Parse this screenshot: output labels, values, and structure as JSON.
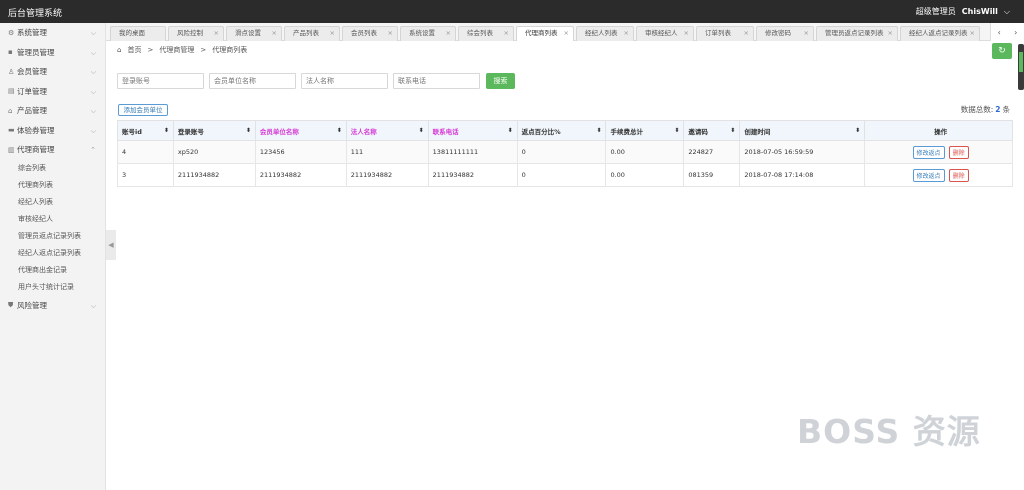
{
  "header": {
    "title": "后台管理系统",
    "role": "超级管理员",
    "username": "ChisWill",
    "caret": "⌵"
  },
  "sidebar": {
    "items": [
      {
        "label": "系统管理",
        "icon": "gear-icon",
        "glyph": "⚙"
      },
      {
        "label": "管理员管理",
        "icon": "user-admin-icon",
        "glyph": "▪"
      },
      {
        "label": "会员管理",
        "icon": "user-icon",
        "glyph": "♙"
      },
      {
        "label": "订单管理",
        "icon": "order-icon",
        "glyph": "▤"
      },
      {
        "label": "产品管理",
        "icon": "product-icon",
        "glyph": "⌂"
      },
      {
        "label": "体验券管理",
        "icon": "ticket-icon",
        "glyph": "▬"
      },
      {
        "label": "代理商管理",
        "icon": "agent-icon",
        "glyph": "▥"
      }
    ],
    "sub_items": [
      "综会列表",
      "代理商列表",
      "经纪人列表",
      "审核经纪人",
      "管理员返点记录列表",
      "经纪人返点记录列表",
      "代理商出金记录",
      "用户头寸统计记录"
    ],
    "risk": {
      "label": "风险管理",
      "icon": "shield-icon",
      "glyph": "⛊"
    },
    "collapse_glyph": "◀"
  },
  "tabs": [
    {
      "label": "我的桌面",
      "closable": false
    },
    {
      "label": "风险控制",
      "closable": true
    },
    {
      "label": "滑点设置",
      "closable": true
    },
    {
      "label": "产品列表",
      "closable": true
    },
    {
      "label": "会员列表",
      "closable": true
    },
    {
      "label": "系统设置",
      "closable": true
    },
    {
      "label": "综会列表",
      "closable": true
    },
    {
      "label": "代理商列表",
      "closable": true,
      "active": true
    },
    {
      "label": "经纪人列表",
      "closable": true
    },
    {
      "label": "审核经纪人",
      "closable": true
    },
    {
      "label": "订单列表",
      "closable": true
    },
    {
      "label": "修改密码",
      "closable": true
    },
    {
      "label": "管理员返点记录列表",
      "closable": true
    },
    {
      "label": "经纪人返点记录列表",
      "closable": true
    }
  ],
  "tab_nav": {
    "prev": "‹",
    "next": "›",
    "close": "×"
  },
  "breadcrumb": {
    "home_glyph": "⌂",
    "items": [
      "首页",
      "代理商管理",
      "代理商列表"
    ],
    "sep": ">"
  },
  "refresh_glyph": "↻",
  "search": {
    "fields": [
      "登录账号",
      "会员单位名称",
      "法人名称",
      "联系电话"
    ],
    "button": "搜索"
  },
  "add_button": "添加会员单位",
  "total": {
    "label": "数据总数:",
    "count": "2",
    "unit": "条"
  },
  "table": {
    "columns": [
      {
        "label": "账号id",
        "sortable": true,
        "magenta": false
      },
      {
        "label": "登录账号",
        "sortable": true,
        "magenta": false
      },
      {
        "label": "会员单位名称",
        "sortable": true,
        "magenta": true
      },
      {
        "label": "法人名称",
        "sortable": true,
        "magenta": true
      },
      {
        "label": "联系电话",
        "sortable": true,
        "magenta": true
      },
      {
        "label": "返点百分比%",
        "sortable": true,
        "magenta": false
      },
      {
        "label": "手续费总计",
        "sortable": true,
        "magenta": false
      },
      {
        "label": "邀请码",
        "sortable": true,
        "magenta": false
      },
      {
        "label": "创建时间",
        "sortable": true,
        "magenta": false
      },
      {
        "label": "操作",
        "sortable": false,
        "magenta": false
      }
    ],
    "sort_glyph": "⬍",
    "rows": [
      [
        "4",
        "xp520",
        "123456",
        "111",
        "13811111111",
        "0",
        "0.00",
        "224827",
        "2018-07-05 16:59:59"
      ],
      [
        "3",
        "2111934882",
        "2111934882",
        "2111934882",
        "2111934882",
        "0",
        "0.00",
        "081359",
        "2018-07-08 17:14:08"
      ]
    ],
    "edit_label": "修改返点",
    "delete_label": "删除"
  },
  "watermark": "BOSS 资源"
}
